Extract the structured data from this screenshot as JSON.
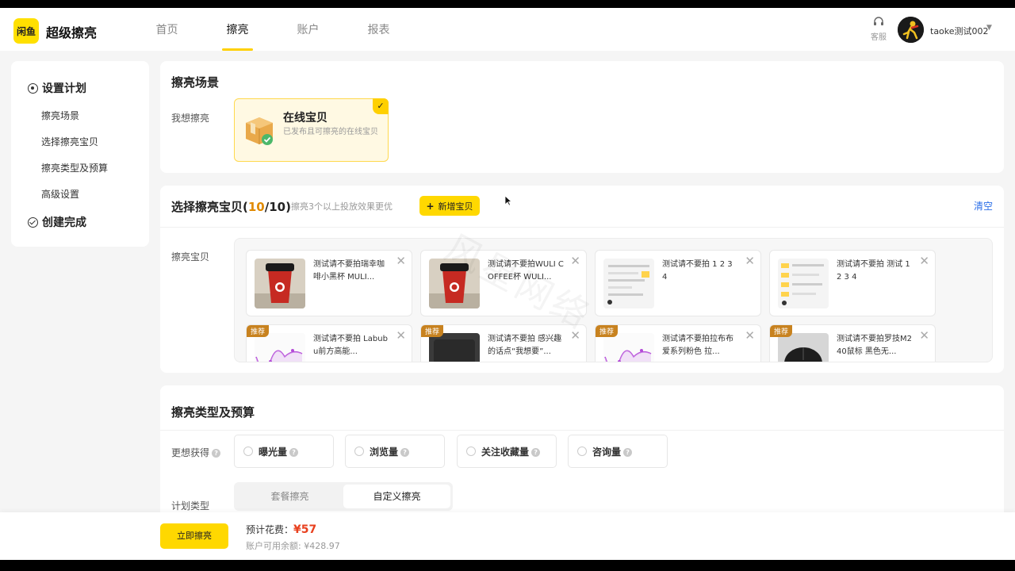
{
  "header": {
    "logo_text": "闲鱼",
    "brand": "超级擦亮",
    "nav": [
      {
        "label": "首页",
        "active": false
      },
      {
        "label": "擦亮",
        "active": true
      },
      {
        "label": "账户",
        "active": false
      },
      {
        "label": "报表",
        "active": false
      }
    ],
    "support_label": "客服",
    "user_name": "taoke测试002"
  },
  "sidebar": {
    "section1": "设置计划",
    "items": [
      "擦亮场景",
      "选择擦亮宝贝",
      "擦亮类型及预算",
      "高级设置"
    ],
    "section2": "创建完成"
  },
  "scene_card": {
    "title": "擦亮场景",
    "field_label": "我想擦亮",
    "option_title": "在线宝贝",
    "option_desc": "已发布且可擦亮的在线宝贝"
  },
  "select_card": {
    "title": "选择擦亮宝贝",
    "count_current": "10",
    "count_total": "/10",
    "hint": "擦亮3个以上投放效果更优",
    "add_button": "新增宝贝",
    "clear_link": "清空",
    "field_label": "擦亮宝贝",
    "recommend_badge": "推荐",
    "items": [
      {
        "title": "测试请不要拍瑞幸咖啡小黑杯 MULI...",
        "thumb": "coffee",
        "recommend": false
      },
      {
        "title": "测试请不要拍WULI COFFEE杯 WULI...",
        "thumb": "coffee",
        "recommend": false
      },
      {
        "title": "测试请不要拍 1 2 3 4",
        "thumb": "screenshot",
        "recommend": false
      },
      {
        "title": "测试请不要拍 测试 1 2 3 4",
        "thumb": "screenshot",
        "recommend": false
      },
      {
        "title": "测试请不要拍 Labubu前方高能...",
        "thumb": "chart",
        "recommend": true
      },
      {
        "title": "测试请不要拍 感兴趣的话点“我想要”...",
        "thumb": "dark",
        "recommend": true
      },
      {
        "title": "测试请不要拍拉布布爱系列粉色 拉...",
        "thumb": "chart",
        "recommend": true
      },
      {
        "title": "测试请不要拍罗技M240鼠标 黑色无...",
        "thumb": "mouse",
        "recommend": true
      }
    ]
  },
  "budget_card": {
    "title": "擦亮类型及预算",
    "goal_label": "更想获得",
    "goals": [
      "曝光量",
      "浏览量",
      "关注收藏量",
      "咨询量"
    ],
    "plan_label": "计划类型",
    "plan_options": [
      {
        "label": "套餐擦亮",
        "active": false
      },
      {
        "label": "自定义擦亮",
        "active": true
      }
    ]
  },
  "bottom": {
    "submit": "立即擦亮",
    "cost_label": "预计花费：",
    "cost_value": "¥57",
    "balance": "账户可用余额: ¥428.97"
  },
  "watermark": "风星网络",
  "colors": {
    "accent": "#ffd800",
    "link": "#2a6ee8",
    "price": "#e8401e",
    "badge": "#c8821f"
  }
}
